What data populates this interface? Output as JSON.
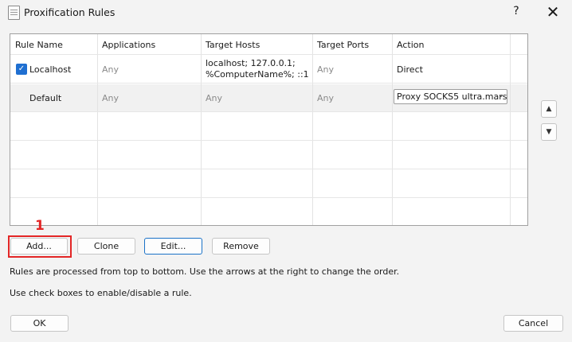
{
  "window": {
    "title": "Proxification Rules",
    "help_label": "?",
    "close_label": "✕"
  },
  "table": {
    "headers": [
      "Rule Name",
      "Applications",
      "Target Hosts",
      "Target Ports",
      "Action"
    ],
    "rows": [
      {
        "enabled": true,
        "name": "Localhost",
        "applications": "Any",
        "hosts_line1": "localhost; 127.0.0.1;",
        "hosts_line2": "%ComputerName%; ::1",
        "ports": "Any",
        "action": "Direct"
      },
      {
        "enabled": null,
        "name": "Default",
        "applications": "Any",
        "hosts": "Any",
        "ports": "Any",
        "action": "Proxy SOCKS5 ultra.mars"
      }
    ]
  },
  "order_buttons": {
    "up": "▲",
    "down": "▼"
  },
  "buttons": {
    "add": "Add...",
    "clone": "Clone",
    "edit": "Edit...",
    "remove": "Remove",
    "ok": "OK",
    "cancel": "Cancel"
  },
  "annotation": {
    "marker": "1"
  },
  "notes": {
    "line1": "Rules are processed from top to bottom. Use the arrows at the right to change the order.",
    "line2": "Use check boxes to enable/disable a rule."
  }
}
